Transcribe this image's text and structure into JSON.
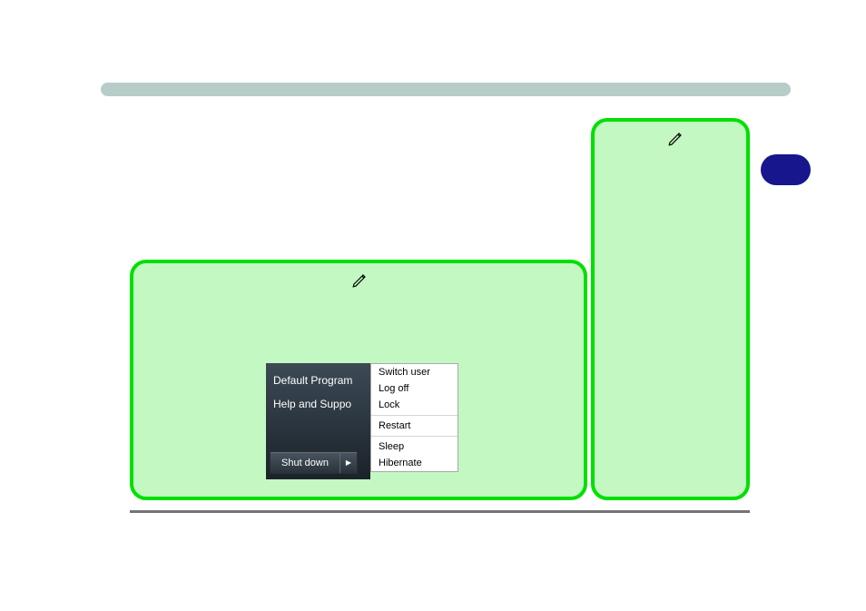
{
  "icons": {
    "pencil": "pencil-icon"
  },
  "start_menu": {
    "items": [
      "Default Program",
      "Help and Suppo"
    ],
    "shutdown_label": "Shut down",
    "arrow_glyph": "▶",
    "flyout": {
      "group1": [
        "Switch user",
        "Log off",
        "Lock"
      ],
      "group2": [
        "Restart"
      ],
      "group3": [
        "Sleep",
        "Hibernate"
      ]
    }
  }
}
